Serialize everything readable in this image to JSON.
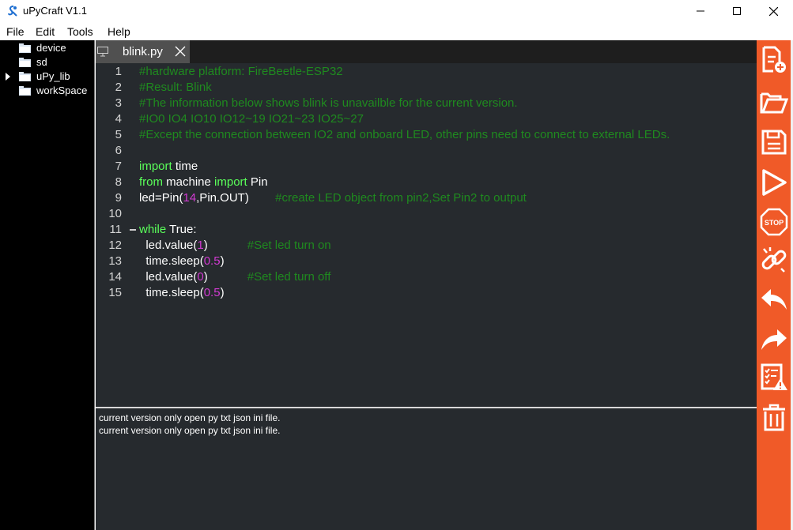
{
  "window": {
    "title": "uPyCraft V1.1",
    "buttons": [
      "minimize-icon",
      "maximize-icon",
      "close-icon"
    ]
  },
  "menu": {
    "items": [
      "File",
      "Edit",
      "Tools",
      "Help"
    ]
  },
  "sidebar": {
    "items": [
      {
        "label": "device",
        "expandable": false
      },
      {
        "label": "sd",
        "expandable": false
      },
      {
        "label": "uPy_lib",
        "expandable": true
      },
      {
        "label": "workSpace",
        "expandable": false
      }
    ]
  },
  "tabs": [
    {
      "label": "blink.py",
      "active": true
    }
  ],
  "editor": {
    "lines": [
      {
        "n": "1",
        "segs": [
          [
            "cm",
            "#hardware platform: FireBeetle-ESP32"
          ]
        ]
      },
      {
        "n": "2",
        "segs": [
          [
            "cm",
            "#Result: Blink"
          ]
        ]
      },
      {
        "n": "3",
        "segs": [
          [
            "cm",
            "#The information below shows blink is unavailble for the current version."
          ]
        ]
      },
      {
        "n": "4",
        "segs": [
          [
            "cm",
            "#IO0 IO4 IO10 IO12~19 IO21~23 IO25~27"
          ]
        ]
      },
      {
        "n": "5",
        "segs": [
          [
            "cm",
            "#Except the connection between IO2 and onboard LED, other pins need to connect to external LEDs."
          ]
        ]
      },
      {
        "n": "6",
        "segs": []
      },
      {
        "n": "7",
        "segs": [
          [
            "kw",
            "import"
          ],
          [
            "pl",
            " time"
          ]
        ]
      },
      {
        "n": "8",
        "segs": [
          [
            "kw",
            "from"
          ],
          [
            "pl",
            " machine "
          ],
          [
            "kw",
            "import"
          ],
          [
            "pl",
            " Pin"
          ]
        ]
      },
      {
        "n": "9",
        "segs": [
          [
            "pl",
            "led=Pin("
          ],
          [
            "num",
            "14"
          ],
          [
            "pl",
            ",Pin.OUT)        "
          ],
          [
            "cm",
            "#create LED object from pin2,Set Pin2 to output"
          ]
        ]
      },
      {
        "n": "10",
        "segs": []
      },
      {
        "n": "11",
        "fold": true,
        "segs": [
          [
            "kw",
            "while"
          ],
          [
            "pl",
            " True:"
          ]
        ]
      },
      {
        "n": "12",
        "segs": [
          [
            "pl",
            "  led.value("
          ],
          [
            "num",
            "1"
          ],
          [
            "pl",
            ")            "
          ],
          [
            "cm",
            "#Set led turn on"
          ]
        ]
      },
      {
        "n": "13",
        "segs": [
          [
            "pl",
            "  time.sleep("
          ],
          [
            "num",
            "0.5"
          ],
          [
            "pl",
            ")"
          ]
        ]
      },
      {
        "n": "14",
        "segs": [
          [
            "pl",
            "  led.value("
          ],
          [
            "num",
            "0"
          ],
          [
            "pl",
            ")            "
          ],
          [
            "cm",
            "#Set led turn off"
          ]
        ]
      },
      {
        "n": "15",
        "segs": [
          [
            "pl",
            "  time.sleep("
          ],
          [
            "num",
            "0.5"
          ],
          [
            "pl",
            ")"
          ]
        ]
      }
    ]
  },
  "console": {
    "lines": [
      "current version only open py txt json ini file.",
      "current version only open py txt json ini file."
    ]
  },
  "toolbar": {
    "tools": [
      "new-file-icon",
      "open-folder-icon",
      "save-icon",
      "run-icon",
      "stop-icon",
      "connect-icon",
      "undo-icon",
      "redo-icon",
      "syntax-check-icon",
      "clear-icon"
    ]
  },
  "colors": {
    "toolbar_bg": "#f05a28",
    "editor_bg": "#262a2e",
    "comment": "#1f8a1f",
    "keyword": "#5aff5a",
    "number": "#d23ad2"
  }
}
